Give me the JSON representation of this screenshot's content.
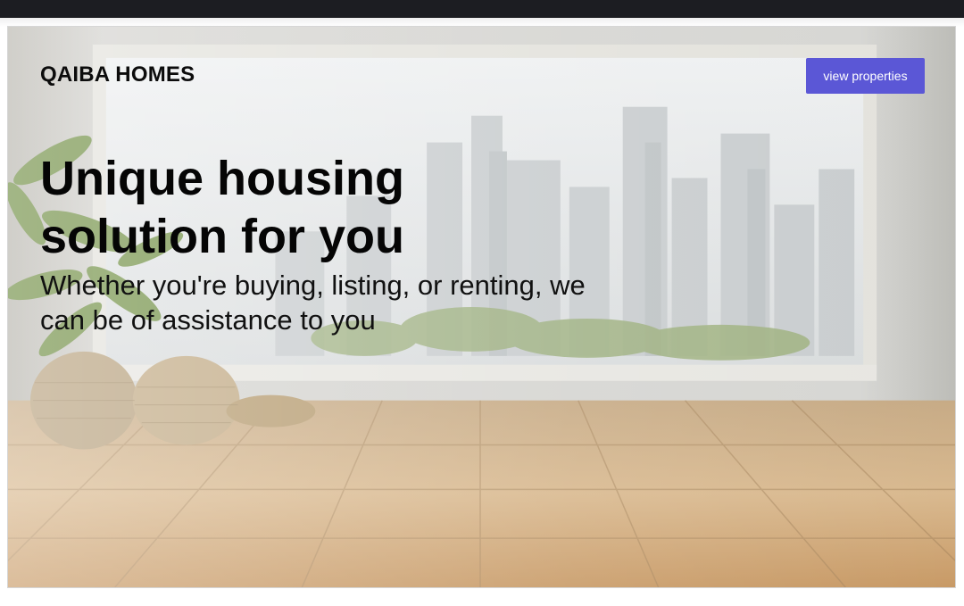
{
  "hero": {
    "brand": "QAIBA HOMES",
    "cta_label": "view properties",
    "headline": "Unique housing solution for you",
    "subheadline": "Whether you're buying, listing, or renting, we can be of assistance to you"
  },
  "colors": {
    "cta_background": "#5b57d6",
    "top_bar": "#1c1d22"
  }
}
